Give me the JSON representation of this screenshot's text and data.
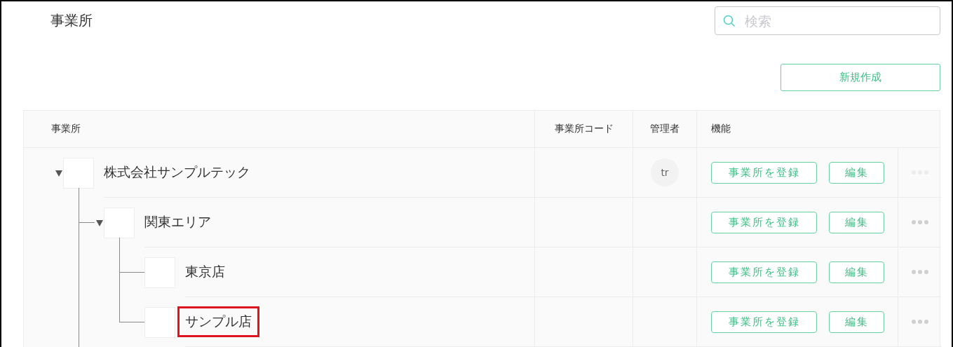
{
  "page": {
    "title": "事業所"
  },
  "search": {
    "placeholder": "検索"
  },
  "new_button": "新規作成",
  "table": {
    "columns": [
      "事業所",
      "事業所コード",
      "管理者",
      "機能"
    ],
    "rows": [
      {
        "name": "株式会社サンプルテック",
        "expanded": true,
        "manager": "tr",
        "actions": [
          "事業所を登録",
          "編集"
        ],
        "more_disabled": true,
        "highlighted": false,
        "children": [
          {
            "name": "関東エリア",
            "expanded": true,
            "actions": [
              "事業所を登録",
              "編集"
            ],
            "more_disabled": false,
            "highlighted": false,
            "children": [
              {
                "name": "東京店",
                "actions": [
                  "事業所を登録",
                  "編集"
                ],
                "more_disabled": false,
                "highlighted": false
              },
              {
                "name": "サンプル店",
                "actions": [
                  "事業所を登録",
                  "編集"
                ],
                "more_disabled": false,
                "highlighted": true
              }
            ]
          }
        ]
      }
    ]
  }
}
